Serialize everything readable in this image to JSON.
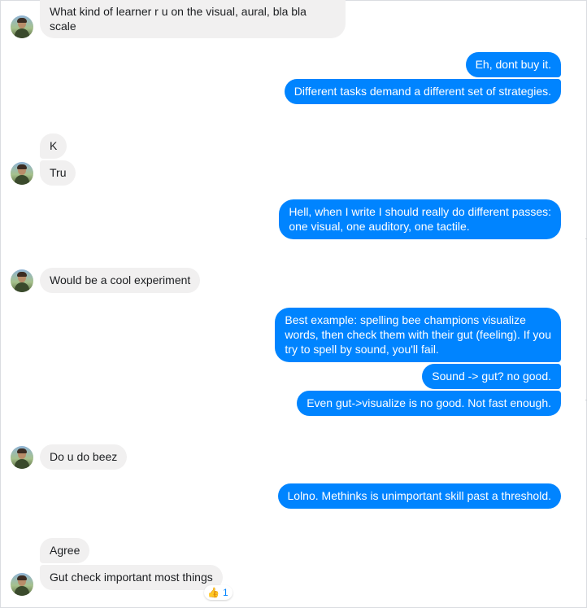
{
  "messages": [
    {
      "id": "m1",
      "side": "in",
      "text_lines": [
        "What kind of learner r u on the visual, aural, bla bla",
        "scale"
      ]
    },
    {
      "id": "m2",
      "side": "out",
      "text_lines": [
        "Eh, dont buy it."
      ]
    },
    {
      "id": "m3",
      "side": "out",
      "text_lines": [
        "Different tasks demand a different set of strategies."
      ]
    },
    {
      "id": "m4",
      "side": "in",
      "text_lines": [
        "K"
      ]
    },
    {
      "id": "m5",
      "side": "in",
      "text_lines": [
        "Tru"
      ]
    },
    {
      "id": "m6",
      "side": "out",
      "text_lines": [
        "Hell, when I write I should really do different passes:",
        "one visual, one auditory, one tactile."
      ]
    },
    {
      "id": "m7",
      "side": "in",
      "text_lines": [
        "Would be a cool experiment"
      ]
    },
    {
      "id": "m8",
      "side": "out",
      "text_lines": [
        "Best example: spelling bee champions visualize",
        "words, then check them with their gut (feeling). If you",
        "try to spell by sound, you'll fail."
      ]
    },
    {
      "id": "m9",
      "side": "out",
      "text_lines": [
        "Sound -> gut? no good."
      ]
    },
    {
      "id": "m10",
      "side": "out",
      "text_lines": [
        "Even gut->visualize is no good. Not fast enough."
      ]
    },
    {
      "id": "m11",
      "side": "in",
      "text_lines": [
        "Do u do beez"
      ]
    },
    {
      "id": "m12",
      "side": "out",
      "text_lines": [
        "Lolno. Methinks is unimportant skill past a threshold."
      ]
    },
    {
      "id": "m13",
      "side": "in",
      "text_lines": [
        "Agree"
      ]
    },
    {
      "id": "m14",
      "side": "in",
      "text_lines": [
        "Gut check important most things"
      ]
    }
  ],
  "reaction": {
    "icon": "thumbs-up-icon",
    "emoji": "👍",
    "count": "1"
  },
  "colors": {
    "outgoing_bubble": "#0084ff",
    "incoming_bubble": "#f1f0f0",
    "incoming_text": "#1c1e21",
    "outgoing_text": "#ffffff"
  }
}
